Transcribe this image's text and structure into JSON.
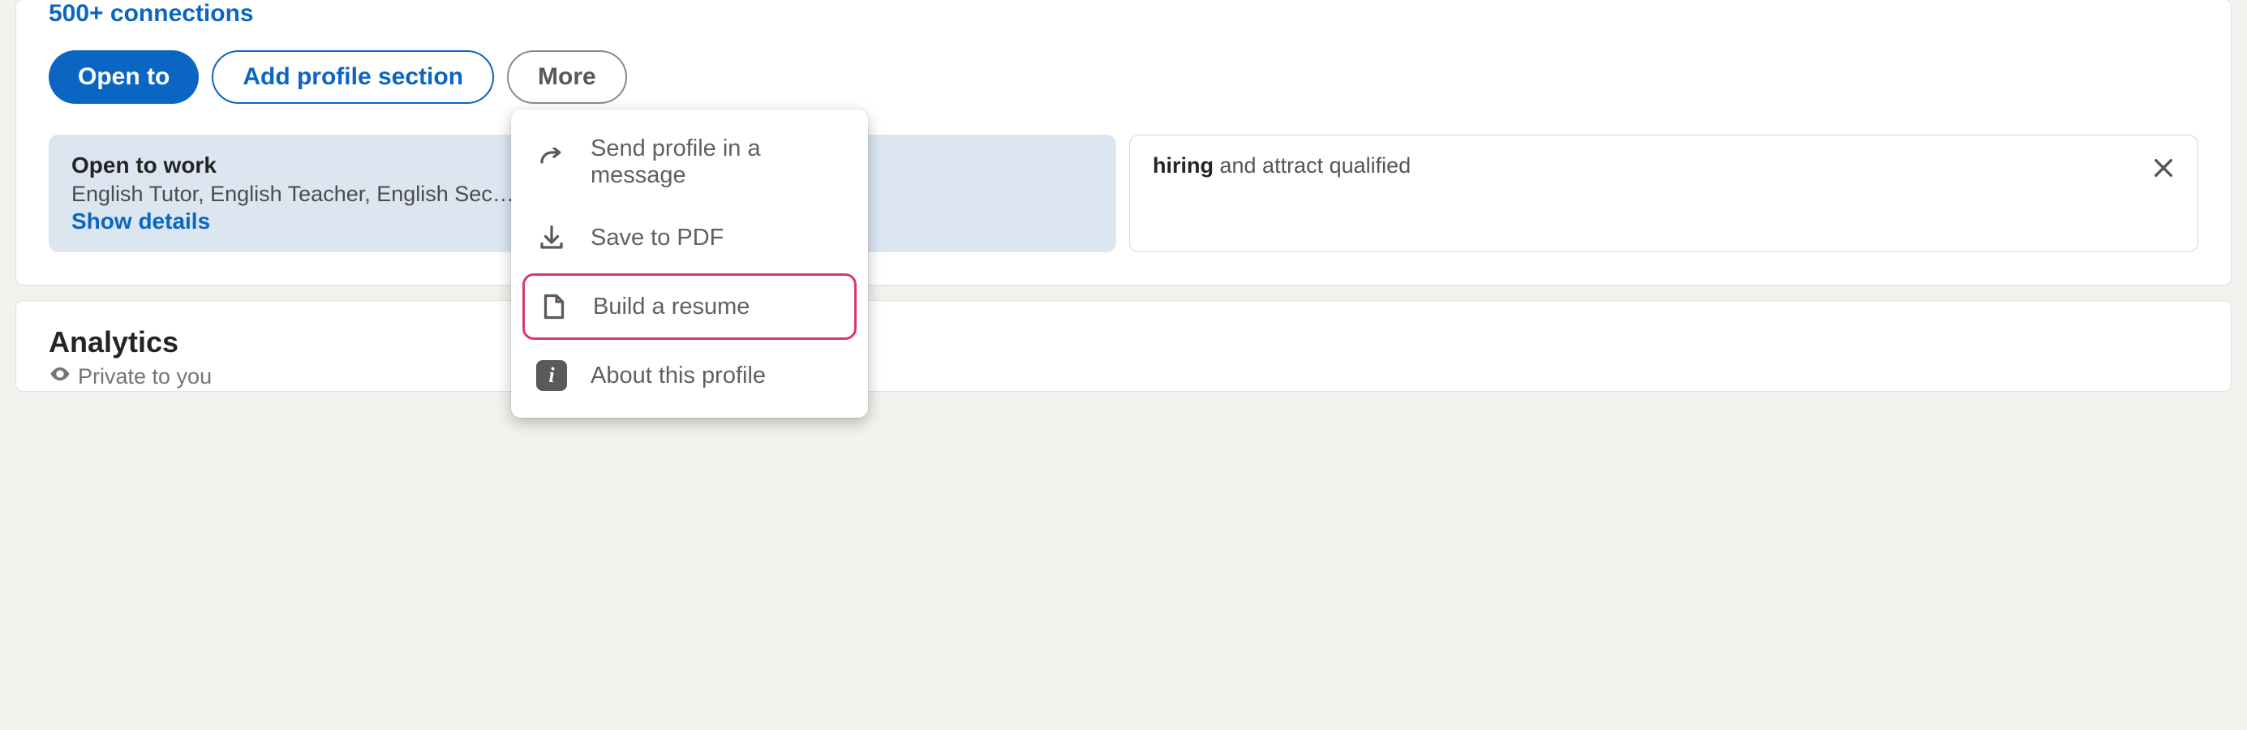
{
  "profile": {
    "connections_text": "500+ connections",
    "buttons": {
      "open_to": "Open to",
      "add_section": "Add profile section",
      "more": "More"
    },
    "open_to_card": {
      "title": "Open to work",
      "subtitle": "English Tutor, English Teacher, English Sec…",
      "show_details": "Show details"
    },
    "hiring_card": {
      "prefix_bold": "hiring",
      "rest": " and attract qualified"
    }
  },
  "dropdown": {
    "send_message": "Send profile in a message",
    "save_pdf": "Save to PDF",
    "build_resume": "Build a resume",
    "about_profile": "About this profile"
  },
  "analytics": {
    "title": "Analytics",
    "private": "Private to you"
  }
}
